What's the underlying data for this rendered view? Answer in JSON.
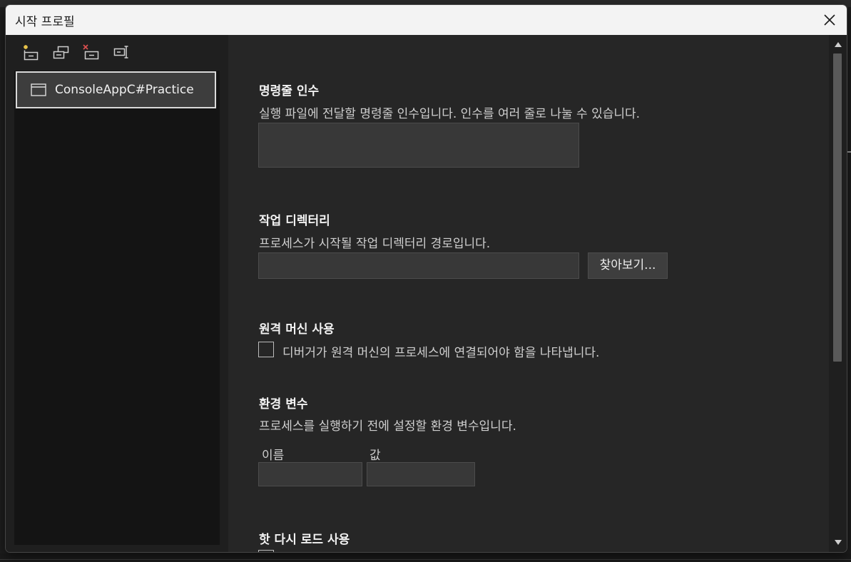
{
  "window": {
    "title": "시작 프로필"
  },
  "toolbar": {
    "buttons": [
      {
        "name": "new-profile-icon"
      },
      {
        "name": "copy-profile-icon"
      },
      {
        "name": "delete-profile-icon"
      },
      {
        "name": "rename-profile-icon"
      }
    ]
  },
  "profiles": {
    "items": [
      {
        "label": "ConsoleAppC#Practice",
        "selected": true
      }
    ]
  },
  "sections": {
    "command_args": {
      "title": "명령줄 인수",
      "description": "실행 파일에 전달할 명령줄 인수입니다. 인수를 여러 줄로 나눌 수 있습니다.",
      "value": ""
    },
    "working_dir": {
      "title": "작업 디렉터리",
      "description": "프로세스가 시작될 작업 디렉터리 경로입니다.",
      "value": "",
      "browse_label": "찾아보기..."
    },
    "remote_machine": {
      "title": "원격 머신 사용",
      "checkbox_label": "디버거가 원격 머신의 프로세스에 연결되어야 함을 나타냅니다.",
      "checked": false
    },
    "env_vars": {
      "title": "환경 변수",
      "description": "프로세스를 실행하기 전에 설정할 환경 변수입니다.",
      "col_name": "이름",
      "col_value": "값"
    },
    "hot_reload": {
      "title": "핫 다시 로드 사용"
    }
  },
  "colors": {
    "accent_new": "#e8c44a",
    "accent_delete": "#e05151",
    "titlebar_bg": "#f3f3f3",
    "content_bg": "#262626"
  }
}
